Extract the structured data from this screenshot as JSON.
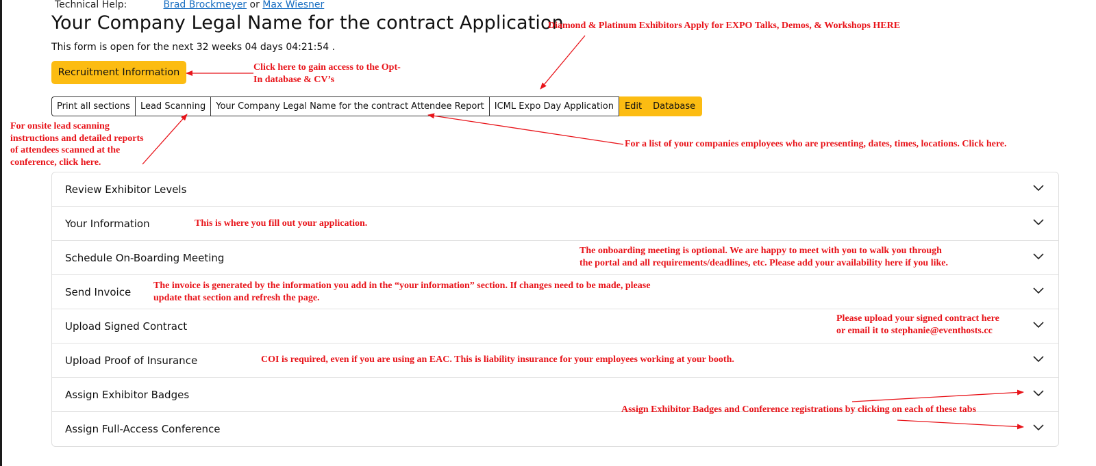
{
  "tech_help": {
    "label": "Technical Help:",
    "contact1": "Brad Brockmeyer",
    "separator": "or",
    "contact2": "Max Wiesner"
  },
  "page_title": "Your Company Legal Name for the contract Application",
  "open_text": "This form is open for the next 32 weeks 04 days 04:21:54 .",
  "recruitment_button": "Recruitment Information",
  "tabs": {
    "print_all": "Print all sections",
    "lead_scanning": "Lead Scanning",
    "attendee_report": "Your Company Legal Name for the contract Attendee Report",
    "expo_day": "ICML Expo Day Application",
    "edit": "Edit",
    "database": "Database"
  },
  "sections": [
    {
      "label": "Review Exhibitor Levels"
    },
    {
      "label": "Your Information"
    },
    {
      "label": "Schedule On-Boarding Meeting"
    },
    {
      "label": "Send Invoice"
    },
    {
      "label": "Upload Signed Contract"
    },
    {
      "label": "Upload Proof of Insurance"
    },
    {
      "label": "Assign Exhibitor Badges"
    },
    {
      "label": "Assign Full-Access Conference"
    }
  ],
  "annotations": {
    "expo_talks": "Diamond & Platinum Exhibitors Apply for EXPO Talks, Demos, & Workshops HERE",
    "optin_line1": "Click here to gain access to the Opt-",
    "optin_line2": "In database &  CV’s",
    "lead_line1": "For onsite lead scanning",
    "lead_line2": "instructions and detailed reports",
    "lead_line3": "of attendees scanned at the",
    "lead_line4": "conference, click here.",
    "employees": "For a list of your companies employees who are presenting, dates, times,  locations. Click here.",
    "your_info": "This is where you fill out your application.",
    "onboard_line1": "The onboarding meeting is optional. We are happy to meet with you to walk you through",
    "onboard_line2": "the portal and all requirements/deadlines, etc. Please add your availability here if you like.",
    "invoice_line1": "The invoice is generated by the information you add in the “your information” section. If changes need to be made, please",
    "invoice_line2": "update that section and refresh the page.",
    "contract_line1": "Please upload your signed contract here",
    "contract_line2": "or email it to stephanie@eventhosts.cc",
    "coi": "COI is required, even if you are using an EAC. This is liability insurance for your employees working at your booth.",
    "badges": "Assign Exhibitor Badges and Conference registrations by clicking on each of these tabs"
  },
  "colors": {
    "accent_yellow": "#fcbc12",
    "annotation_red": "#e8141a",
    "link_blue": "#1a6fc2"
  },
  "icons": {
    "section_toggle": "chevron-down-icon"
  }
}
